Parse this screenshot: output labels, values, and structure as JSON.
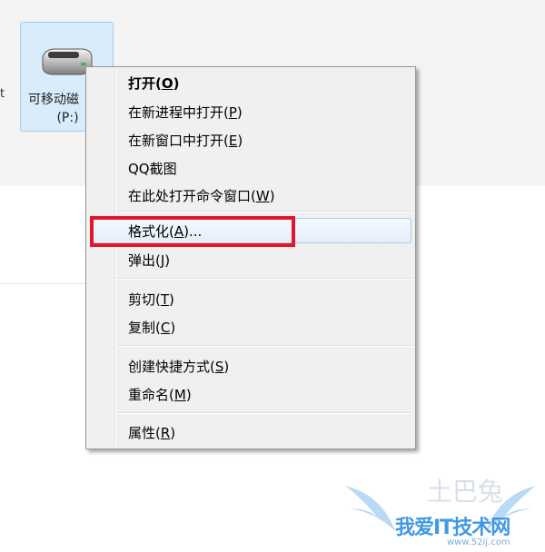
{
  "explorer": {
    "edge_char": "t",
    "drive": {
      "name": "可移动磁",
      "letter": "(P:)",
      "icon": "removable-drive-icon"
    }
  },
  "context_menu": {
    "items": [
      {
        "pre": "打开(",
        "key": "O",
        "post": ")"
      },
      {
        "pre": "在新进程中打开(",
        "key": "P",
        "post": ")"
      },
      {
        "pre": "在新窗口中打开(",
        "key": "E",
        "post": ")"
      },
      {
        "pre": "QQ截图",
        "key": "",
        "post": ""
      },
      {
        "pre": "在此处打开命令窗口(",
        "key": "W",
        "post": ")"
      },
      {
        "pre": "格式化(",
        "key": "A",
        "post": ")..."
      },
      {
        "pre": "弹出(",
        "key": "J",
        "post": ")"
      },
      {
        "pre": "剪切(",
        "key": "T",
        "post": ")"
      },
      {
        "pre": "复制(",
        "key": "C",
        "post": ")"
      },
      {
        "pre": "创建快捷方式(",
        "key": "S",
        "post": ")"
      },
      {
        "pre": "重命名(",
        "key": "M",
        "post": ")"
      },
      {
        "pre": "属性(",
        "key": "R",
        "post": ")"
      }
    ],
    "highlight_color": "#e3162c"
  },
  "watermark": {
    "text": "我爱IT技术网",
    "url": "www.52ij.com",
    "logo": "土巴兔"
  }
}
